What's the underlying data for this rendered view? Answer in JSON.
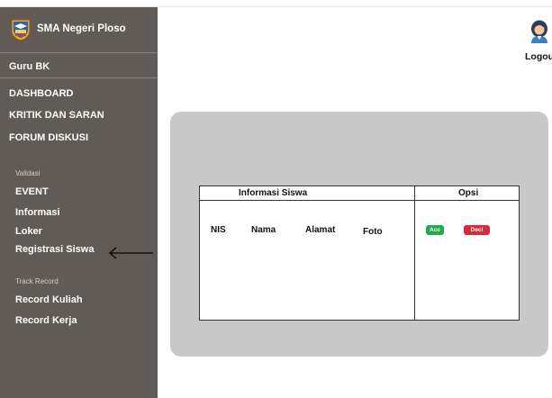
{
  "colors": {
    "sidebar_bg": "#625a56",
    "panel_bg": "#c8c8c8",
    "acc_button": "#22a94a",
    "decl_button": "#d82a3e"
  },
  "sidebar": {
    "school_name": "SMA Negeri Ploso",
    "role": "Guru BK",
    "main_nav": [
      {
        "label": "DASHBOARD"
      },
      {
        "label": "KRITIK DAN SARAN"
      },
      {
        "label": "FORUM DISKUSI"
      }
    ],
    "validasi": {
      "label": "Validasi",
      "items": [
        {
          "label": "EVENT"
        },
        {
          "label": "Informasi"
        },
        {
          "label": "Loker"
        },
        {
          "label": "Registrasi Siswa"
        }
      ]
    },
    "track_record": {
      "label": "Track Record",
      "items": [
        {
          "label": "Record Kuliah"
        },
        {
          "label": "Record Kerja"
        }
      ]
    }
  },
  "header": {
    "logout_label": "Logout",
    "user_icon": "user-avatar-icon"
  },
  "table": {
    "header_info": "Informasi  Siswa",
    "header_opsi": "Opsi",
    "columns": [
      "NIS",
      "Nama",
      "Alamat",
      "Foto"
    ],
    "acc_label": "Acc",
    "decl_label": "Decl"
  }
}
